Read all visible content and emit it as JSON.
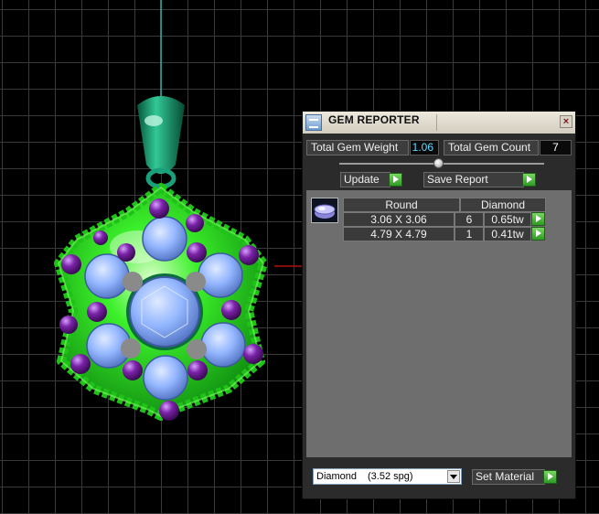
{
  "panel": {
    "title": "GEM REPORTER",
    "close": "×",
    "total_gem_weight_label": "Total Gem Weight",
    "total_gem_weight_value": "1.06",
    "total_gem_count_label": "Total Gem Count",
    "total_gem_count_value": "7",
    "update_label": "Update",
    "save_report_label": "Save Report",
    "table": {
      "headers": [
        "Round",
        "Diamond"
      ],
      "rows": [
        {
          "size": "3.06 X 3.06",
          "count": "6",
          "weight": "0.65tw"
        },
        {
          "size": "4.79 X 4.79",
          "count": "1",
          "weight": "0.41tw"
        }
      ]
    },
    "material_name": "Diamond",
    "material_spg": "(3.52 spg)",
    "set_material_label": "Set Material"
  },
  "colors": {
    "metal_green": "#2ee81e",
    "gem_blue": "#8fb6ff",
    "bead_purple": "#6a1a8a",
    "bail_green": "#0f8a5a",
    "value_cyan": "#5fd8ff",
    "button_green": "#3faa30"
  },
  "icons": [
    "gem-reporter-icon",
    "close-icon",
    "play-arrow-icon",
    "chevron-down-icon",
    "diamond-icon"
  ]
}
